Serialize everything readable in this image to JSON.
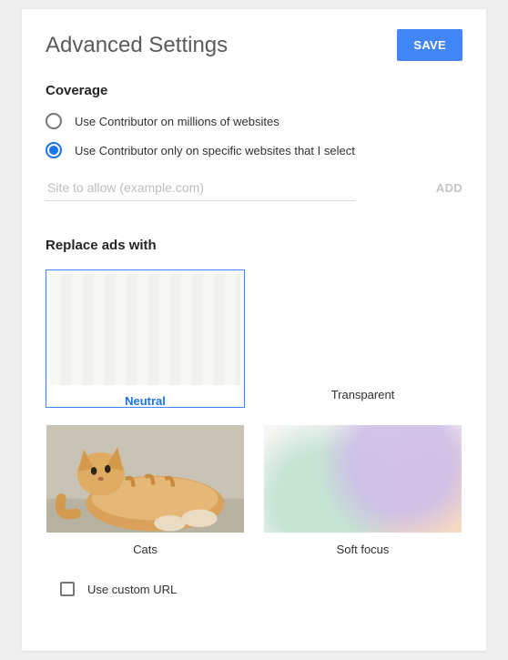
{
  "header": {
    "title": "Advanced Settings",
    "save_label": "SAVE"
  },
  "coverage": {
    "title": "Coverage",
    "options": [
      {
        "label": "Use Contributor on millions of websites",
        "selected": false
      },
      {
        "label": "Use Contributor only on specific websites that I select",
        "selected": true
      }
    ],
    "site_placeholder": "Site to allow (example.com)",
    "site_value": "",
    "add_label": "ADD"
  },
  "replace": {
    "title": "Replace ads with",
    "options": [
      {
        "label": "Neutral",
        "selected": true
      },
      {
        "label": "Transparent",
        "selected": false
      },
      {
        "label": "Cats",
        "selected": false
      },
      {
        "label": "Soft focus",
        "selected": false
      }
    ],
    "custom_url_label": "Use custom URL",
    "custom_url_checked": false
  }
}
